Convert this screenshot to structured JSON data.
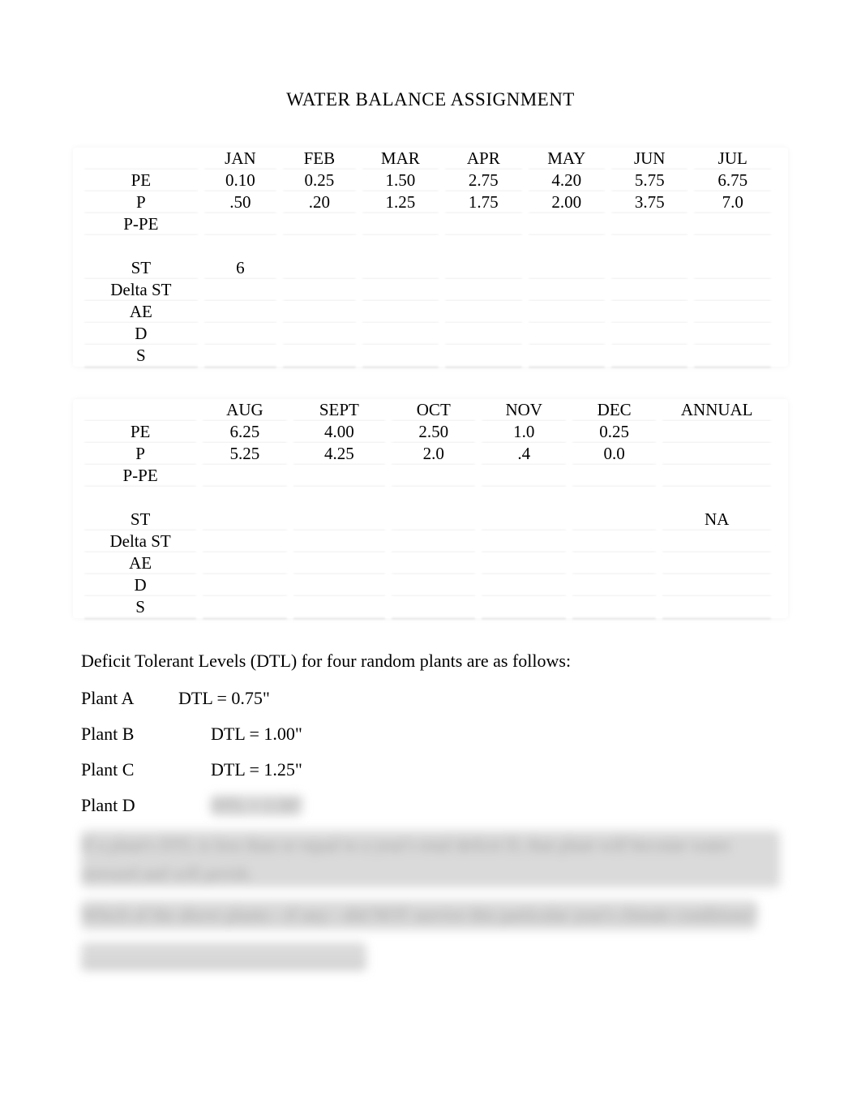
{
  "title": "WATER BALANCE ASSIGNMENT",
  "table1": {
    "headers": [
      "JAN",
      "FEB",
      "MAR",
      "APR",
      "MAY",
      "JUN",
      "JUL"
    ],
    "rows": [
      {
        "label": "PE",
        "cells": [
          "0.10",
          "0.25",
          "1.50",
          "2.75",
          "4.20",
          "5.75",
          "6.75"
        ]
      },
      {
        "label": "P",
        "cells": [
          ".50",
          ".20",
          "1.25",
          "1.75",
          "2.00",
          "3.75",
          "7.0"
        ]
      },
      {
        "label": "P-PE",
        "cells": [
          "",
          "",
          "",
          "",
          "",
          "",
          ""
        ]
      },
      {
        "label": "",
        "cells": [
          "",
          "",
          "",
          "",
          "",
          "",
          ""
        ]
      },
      {
        "label": "ST",
        "cells": [
          "6",
          "",
          "",
          "",
          "",
          "",
          ""
        ]
      },
      {
        "label": "Delta ST",
        "cells": [
          "",
          "",
          "",
          "",
          "",
          "",
          ""
        ]
      },
      {
        "label": "AE",
        "cells": [
          "",
          "",
          "",
          "",
          "",
          "",
          ""
        ]
      },
      {
        "label": "D",
        "cells": [
          "",
          "",
          "",
          "",
          "",
          "",
          ""
        ]
      },
      {
        "label": "S",
        "cells": [
          "",
          "",
          "",
          "",
          "",
          "",
          ""
        ]
      }
    ]
  },
  "table2": {
    "headers": [
      "AUG",
      "SEPT",
      "OCT",
      "NOV",
      "DEC",
      "ANNUAL"
    ],
    "rows": [
      {
        "label": "PE",
        "cells": [
          "6.25",
          "4.00",
          "2.50",
          "1.0",
          "0.25",
          ""
        ]
      },
      {
        "label": "P",
        "cells": [
          "5.25",
          "4.25",
          "2.0",
          ".4",
          "0.0",
          ""
        ]
      },
      {
        "label": "P-PE",
        "cells": [
          "",
          "",
          "",
          "",
          "",
          ""
        ]
      },
      {
        "label": "",
        "cells": [
          "",
          "",
          "",
          "",
          "",
          ""
        ]
      },
      {
        "label": "ST",
        "cells": [
          "",
          "",
          "",
          "",
          "",
          "NA"
        ]
      },
      {
        "label": "Delta ST",
        "cells": [
          "",
          "",
          "",
          "",
          "",
          ""
        ]
      },
      {
        "label": "AE",
        "cells": [
          "",
          "",
          "",
          "",
          "",
          ""
        ]
      },
      {
        "label": "D",
        "cells": [
          "",
          "",
          "",
          "",
          "",
          ""
        ]
      },
      {
        "label": "S",
        "cells": [
          "",
          "",
          "",
          "",
          "",
          ""
        ]
      }
    ]
  },
  "dtl_intro": "Deficit Tolerant Levels (DTL) for four random plants are as follows:",
  "plants": [
    {
      "name": "Plant A",
      "dtl": "DTL = 0.75\"",
      "blurred": false,
      "indent": "0"
    },
    {
      "name": "Plant B",
      "dtl": "DTL = 1.00\"",
      "blurred": false,
      "indent": "40"
    },
    {
      "name": "Plant C",
      "dtl": "DTL = 1.25\"",
      "blurred": false,
      "indent": "40"
    },
    {
      "name": "Plant D",
      "dtl": "DTL = 1.50\"",
      "blurred": true,
      "indent": "40"
    }
  ],
  "blurred_lines": [
    "If a plant's DTL is less than or equal to a year's total deficit D, that plant will become water stressed and will perish.",
    "Which of the above plants—if any—did NOT survive this particular year's climate conditions?",
    "________________________________"
  ]
}
